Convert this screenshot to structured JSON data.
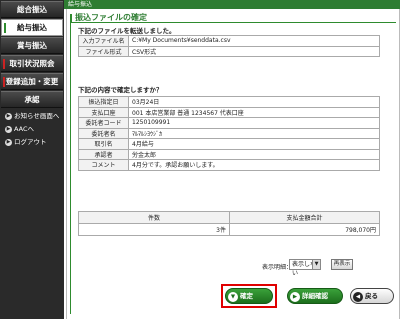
{
  "sidebar": {
    "items": [
      {
        "label": "総合振込"
      },
      {
        "label": "給与振込"
      },
      {
        "label": "賞与振込"
      },
      {
        "label": "取引状況照会"
      },
      {
        "label": "登録追加・変更"
      },
      {
        "label": "承認"
      }
    ],
    "links": [
      {
        "label": "お知らせ画面へ"
      },
      {
        "label": "AACへ"
      },
      {
        "label": "ログアウト"
      }
    ]
  },
  "header": {
    "breadcrumb": "給与振込"
  },
  "page": {
    "title": "振込ファイルの確定"
  },
  "file_section": {
    "heading": "下記のファイルを転送しました。",
    "rows": [
      {
        "key": "入力ファイル名",
        "value": "C:¥My Documents¥senddata.csv"
      },
      {
        "key": "ファイル形式",
        "value": "CSV形式"
      }
    ]
  },
  "confirm_section": {
    "heading": "下記の内容で確定しますか？",
    "rows": [
      {
        "key": "振込指定日",
        "value": "03月24日"
      },
      {
        "key": "支払口座",
        "value": "001 本店営業部 普通 1234567 代表口座"
      },
      {
        "key": "委託者コード",
        "value": "1250109991"
      },
      {
        "key": "委託者名",
        "value": "ﾏﾙﾏﾙｼﾖｳｼﾞｶ"
      },
      {
        "key": "取引名",
        "value": "4月給与"
      },
      {
        "key": "承認者",
        "value": "労金太郎"
      },
      {
        "key": "コメント",
        "value": "4月分です。承認お願いします。"
      }
    ]
  },
  "summary": {
    "headers": [
      "件数",
      "支払金額合計"
    ],
    "row": [
      "3件",
      "798,070円"
    ]
  },
  "display": {
    "label": "表示明細：",
    "selected": "表示しない",
    "redisplay": "再表示"
  },
  "buttons": {
    "confirm": "確定",
    "detail": "詳細確認",
    "back": "戻る"
  },
  "colors": {
    "accent_green": "#2e7d32",
    "sidebar_bg": "#2a2a2a",
    "highlight_red": "#e00000"
  }
}
